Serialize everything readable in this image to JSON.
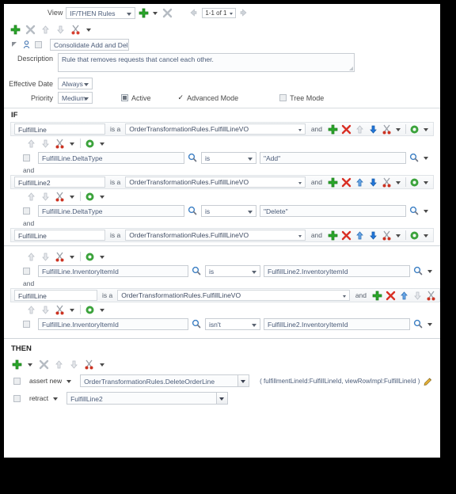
{
  "header": {
    "view_label": "View",
    "view_value": "IF/THEN Rules",
    "add_icon": "add-icon",
    "add_menu_icon": "chevron-down-icon",
    "delete_icon": "delete-x-icon",
    "prev_icon": "previous-arrow-icon",
    "pager_value": "1-1 of 1",
    "next_icon": "next-arrow-icon"
  },
  "rule_toolbar": {
    "add_icon": "add-icon",
    "delete_icon": "delete-x-icon",
    "move_up_icon": "arrow-up-icon",
    "move_down_icon": "arrow-down-icon",
    "cut_icon": "scissors-icon",
    "menu_icon": "chevron-down-icon"
  },
  "rule": {
    "expand_icon": "expand-triangle-icon",
    "person_icon": "user-icon",
    "name": "Consolidate Add and Delete A",
    "description_label": "Description",
    "description": "Rule that removes requests that cancel each other.",
    "effective_date_label": "Effective Date",
    "effective_date": "Always",
    "priority_label": "Priority",
    "priority": "Medium",
    "active_label": "Active",
    "active_checked": true,
    "advanced_mode_label": "Advanced Mode",
    "advanced_mode_checked": true,
    "tree_mode_label": "Tree Mode",
    "tree_mode_checked": false
  },
  "if_section": {
    "title": "IF",
    "is_a_label": "is a",
    "and_label": "and",
    "and_joiner": "and",
    "patterns": [
      {
        "name": "FulfillLine",
        "type": "OrderTransformationRules.FulfillLineVO",
        "conditions": [
          {
            "left": "FulfillLine.DeltaType",
            "op": "is",
            "right": "\"Add\""
          }
        ]
      },
      {
        "name": "FulfillLine2",
        "type": "OrderTransformationRules.FulfillLineVO",
        "conditions": [
          {
            "left": "FulfillLine.DeltaType",
            "op": "is",
            "right": "\"Delete\""
          }
        ]
      },
      {
        "name": "FulfillLine",
        "type": "OrderTransformationRules.FulfillLineVO",
        "conditions": [
          {
            "left": "FulfillLine.InventoryItemId",
            "op": "is",
            "right": "FulfillLine2.InventoryItemId"
          }
        ]
      },
      {
        "name": "FulfillLine",
        "type": "OrderTransformationRules.FulfillLineVO",
        "conditions": [
          {
            "left": "FulfillLine.InventoryItemId",
            "op": "isn't",
            "right": "FulfillLine2.InventoryItemId"
          }
        ]
      }
    ]
  },
  "then_section": {
    "title": "THEN",
    "toolbar": {
      "add_icon": "add-icon",
      "add_menu_icon": "chevron-down-icon",
      "delete_icon": "delete-x-icon",
      "move_up_icon": "arrow-up-icon",
      "move_down_icon": "arrow-down-icon",
      "cut_icon": "scissors-icon",
      "menu_icon": "chevron-down-icon"
    },
    "actions": [
      {
        "verb": "assert new",
        "target": "OrderTransformationRules.DeleteOrderLine",
        "params": "( fulfillmentLineId:FulfillLineId, viewRowImpl:FulfillLineId )",
        "edit_icon": "edit-pencil-icon"
      },
      {
        "verb": "retract",
        "target": "FulfillLine2",
        "params": "",
        "edit_icon": ""
      }
    ]
  },
  "colors": {
    "add_green": "#2aa72a",
    "delete_red": "#d93025",
    "arrow_blue": "#2277dd",
    "arrow_grey": "#b9bfc6",
    "gear_green": "#3ca33c",
    "scissors_red": "#cc3322"
  }
}
